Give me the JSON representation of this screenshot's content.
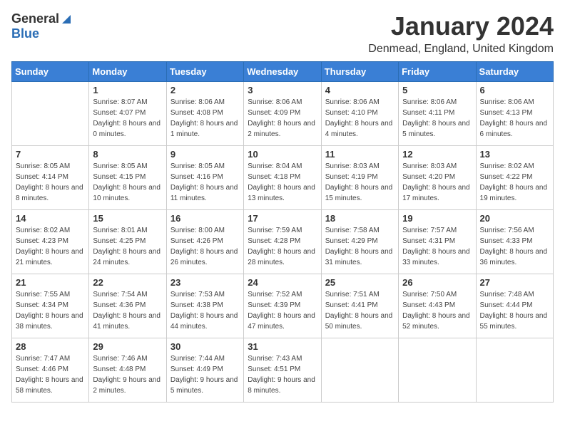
{
  "header": {
    "logo_general": "General",
    "logo_blue": "Blue",
    "month": "January 2024",
    "location": "Denmead, England, United Kingdom"
  },
  "days_of_week": [
    "Sunday",
    "Monday",
    "Tuesday",
    "Wednesday",
    "Thursday",
    "Friday",
    "Saturday"
  ],
  "weeks": [
    [
      {
        "day": "",
        "sunrise": "",
        "sunset": "",
        "daylight": ""
      },
      {
        "day": "1",
        "sunrise": "Sunrise: 8:07 AM",
        "sunset": "Sunset: 4:07 PM",
        "daylight": "Daylight: 8 hours and 0 minutes."
      },
      {
        "day": "2",
        "sunrise": "Sunrise: 8:06 AM",
        "sunset": "Sunset: 4:08 PM",
        "daylight": "Daylight: 8 hours and 1 minute."
      },
      {
        "day": "3",
        "sunrise": "Sunrise: 8:06 AM",
        "sunset": "Sunset: 4:09 PM",
        "daylight": "Daylight: 8 hours and 2 minutes."
      },
      {
        "day": "4",
        "sunrise": "Sunrise: 8:06 AM",
        "sunset": "Sunset: 4:10 PM",
        "daylight": "Daylight: 8 hours and 4 minutes."
      },
      {
        "day": "5",
        "sunrise": "Sunrise: 8:06 AM",
        "sunset": "Sunset: 4:11 PM",
        "daylight": "Daylight: 8 hours and 5 minutes."
      },
      {
        "day": "6",
        "sunrise": "Sunrise: 8:06 AM",
        "sunset": "Sunset: 4:13 PM",
        "daylight": "Daylight: 8 hours and 6 minutes."
      }
    ],
    [
      {
        "day": "7",
        "sunrise": "Sunrise: 8:05 AM",
        "sunset": "Sunset: 4:14 PM",
        "daylight": "Daylight: 8 hours and 8 minutes."
      },
      {
        "day": "8",
        "sunrise": "Sunrise: 8:05 AM",
        "sunset": "Sunset: 4:15 PM",
        "daylight": "Daylight: 8 hours and 10 minutes."
      },
      {
        "day": "9",
        "sunrise": "Sunrise: 8:05 AM",
        "sunset": "Sunset: 4:16 PM",
        "daylight": "Daylight: 8 hours and 11 minutes."
      },
      {
        "day": "10",
        "sunrise": "Sunrise: 8:04 AM",
        "sunset": "Sunset: 4:18 PM",
        "daylight": "Daylight: 8 hours and 13 minutes."
      },
      {
        "day": "11",
        "sunrise": "Sunrise: 8:03 AM",
        "sunset": "Sunset: 4:19 PM",
        "daylight": "Daylight: 8 hours and 15 minutes."
      },
      {
        "day": "12",
        "sunrise": "Sunrise: 8:03 AM",
        "sunset": "Sunset: 4:20 PM",
        "daylight": "Daylight: 8 hours and 17 minutes."
      },
      {
        "day": "13",
        "sunrise": "Sunrise: 8:02 AM",
        "sunset": "Sunset: 4:22 PM",
        "daylight": "Daylight: 8 hours and 19 minutes."
      }
    ],
    [
      {
        "day": "14",
        "sunrise": "Sunrise: 8:02 AM",
        "sunset": "Sunset: 4:23 PM",
        "daylight": "Daylight: 8 hours and 21 minutes."
      },
      {
        "day": "15",
        "sunrise": "Sunrise: 8:01 AM",
        "sunset": "Sunset: 4:25 PM",
        "daylight": "Daylight: 8 hours and 24 minutes."
      },
      {
        "day": "16",
        "sunrise": "Sunrise: 8:00 AM",
        "sunset": "Sunset: 4:26 PM",
        "daylight": "Daylight: 8 hours and 26 minutes."
      },
      {
        "day": "17",
        "sunrise": "Sunrise: 7:59 AM",
        "sunset": "Sunset: 4:28 PM",
        "daylight": "Daylight: 8 hours and 28 minutes."
      },
      {
        "day": "18",
        "sunrise": "Sunrise: 7:58 AM",
        "sunset": "Sunset: 4:29 PM",
        "daylight": "Daylight: 8 hours and 31 minutes."
      },
      {
        "day": "19",
        "sunrise": "Sunrise: 7:57 AM",
        "sunset": "Sunset: 4:31 PM",
        "daylight": "Daylight: 8 hours and 33 minutes."
      },
      {
        "day": "20",
        "sunrise": "Sunrise: 7:56 AM",
        "sunset": "Sunset: 4:33 PM",
        "daylight": "Daylight: 8 hours and 36 minutes."
      }
    ],
    [
      {
        "day": "21",
        "sunrise": "Sunrise: 7:55 AM",
        "sunset": "Sunset: 4:34 PM",
        "daylight": "Daylight: 8 hours and 38 minutes."
      },
      {
        "day": "22",
        "sunrise": "Sunrise: 7:54 AM",
        "sunset": "Sunset: 4:36 PM",
        "daylight": "Daylight: 8 hours and 41 minutes."
      },
      {
        "day": "23",
        "sunrise": "Sunrise: 7:53 AM",
        "sunset": "Sunset: 4:38 PM",
        "daylight": "Daylight: 8 hours and 44 minutes."
      },
      {
        "day": "24",
        "sunrise": "Sunrise: 7:52 AM",
        "sunset": "Sunset: 4:39 PM",
        "daylight": "Daylight: 8 hours and 47 minutes."
      },
      {
        "day": "25",
        "sunrise": "Sunrise: 7:51 AM",
        "sunset": "Sunset: 4:41 PM",
        "daylight": "Daylight: 8 hours and 50 minutes."
      },
      {
        "day": "26",
        "sunrise": "Sunrise: 7:50 AM",
        "sunset": "Sunset: 4:43 PM",
        "daylight": "Daylight: 8 hours and 52 minutes."
      },
      {
        "day": "27",
        "sunrise": "Sunrise: 7:48 AM",
        "sunset": "Sunset: 4:44 PM",
        "daylight": "Daylight: 8 hours and 55 minutes."
      }
    ],
    [
      {
        "day": "28",
        "sunrise": "Sunrise: 7:47 AM",
        "sunset": "Sunset: 4:46 PM",
        "daylight": "Daylight: 8 hours and 58 minutes."
      },
      {
        "day": "29",
        "sunrise": "Sunrise: 7:46 AM",
        "sunset": "Sunset: 4:48 PM",
        "daylight": "Daylight: 9 hours and 2 minutes."
      },
      {
        "day": "30",
        "sunrise": "Sunrise: 7:44 AM",
        "sunset": "Sunset: 4:49 PM",
        "daylight": "Daylight: 9 hours and 5 minutes."
      },
      {
        "day": "31",
        "sunrise": "Sunrise: 7:43 AM",
        "sunset": "Sunset: 4:51 PM",
        "daylight": "Daylight: 9 hours and 8 minutes."
      },
      {
        "day": "",
        "sunrise": "",
        "sunset": "",
        "daylight": ""
      },
      {
        "day": "",
        "sunrise": "",
        "sunset": "",
        "daylight": ""
      },
      {
        "day": "",
        "sunrise": "",
        "sunset": "",
        "daylight": ""
      }
    ]
  ]
}
